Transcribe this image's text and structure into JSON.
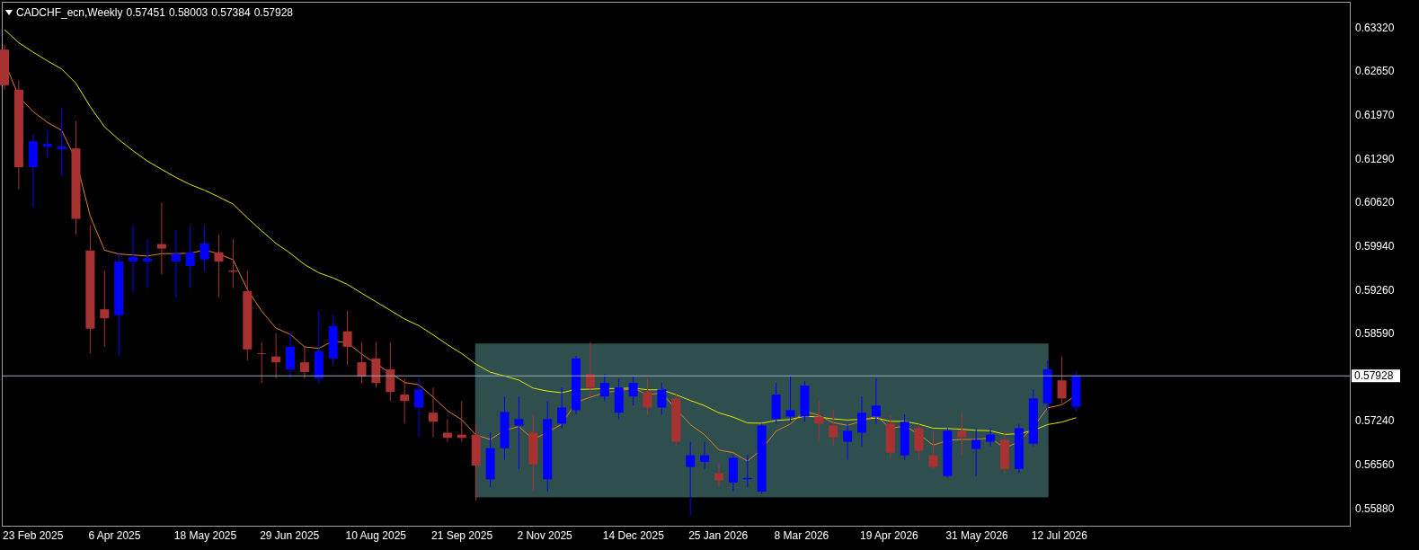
{
  "header": {
    "symbol": "CADCHF_ecn,Weekly",
    "values": [
      "0.57451",
      "0.58003",
      "0.57384",
      "0.57928"
    ]
  },
  "price_axis": [
    "0.63320",
    "0.62650",
    "0.61970",
    "0.61290",
    "0.60620",
    "0.59940",
    "0.59260",
    "0.58590",
    "0.57240",
    "0.56560",
    "0.55880"
  ],
  "price_label": "0.57928",
  "date_axis": [
    "23 Feb 2025",
    "6 Apr 2025",
    "18 May 2025",
    "29 Jun 2025",
    "10 Aug 2025",
    "21 Sep 2025",
    "2 Nov 2025",
    "14 Dec 2025",
    "25 Jan 2026",
    "8 Mar 2026",
    "19 Apr 2026",
    "31 May 2026",
    "12 Jul 2026"
  ]
}
